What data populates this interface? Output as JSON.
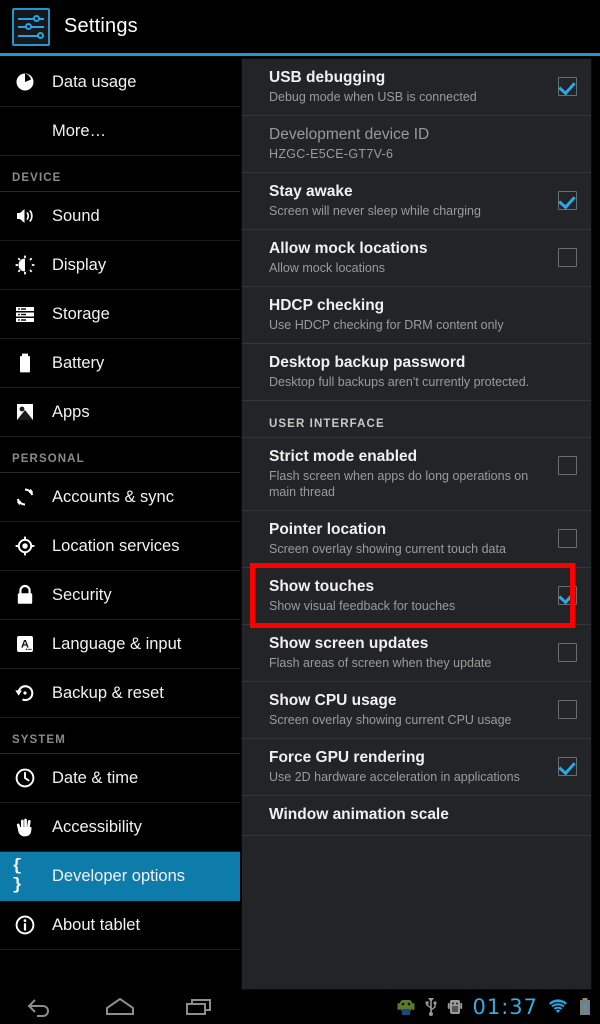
{
  "header": {
    "title": "Settings",
    "icon": "settings-sliders-icon",
    "accent_color": "#2196cf"
  },
  "sidebar": {
    "highlight_color": "#0d7cab",
    "items": [
      {
        "label": "Data usage",
        "icon": "pie-chart-icon",
        "type": "item",
        "selected": false
      },
      {
        "label": "More…",
        "icon": "",
        "type": "item-no-icon",
        "selected": false
      },
      {
        "label": "DEVICE",
        "type": "group"
      },
      {
        "label": "Sound",
        "icon": "speaker-icon",
        "type": "item",
        "selected": false
      },
      {
        "label": "Display",
        "icon": "brightness-icon",
        "type": "item",
        "selected": false
      },
      {
        "label": "Storage",
        "icon": "storage-stack-icon",
        "type": "item",
        "selected": false
      },
      {
        "label": "Battery",
        "icon": "battery-icon",
        "type": "item",
        "selected": false
      },
      {
        "label": "Apps",
        "icon": "android-apps-icon",
        "type": "item",
        "selected": false
      },
      {
        "label": "PERSONAL",
        "type": "group"
      },
      {
        "label": "Accounts & sync",
        "icon": "sync-arrows-icon",
        "type": "item",
        "selected": false
      },
      {
        "label": "Location services",
        "icon": "location-target-icon",
        "type": "item",
        "selected": false
      },
      {
        "label": "Security",
        "icon": "lock-icon",
        "type": "item",
        "selected": false
      },
      {
        "label": "Language & input",
        "icon": "language-a-icon",
        "type": "item",
        "selected": false
      },
      {
        "label": "Backup & reset",
        "icon": "restore-arrow-icon",
        "type": "item",
        "selected": false
      },
      {
        "label": "SYSTEM",
        "type": "group"
      },
      {
        "label": "Date & time",
        "icon": "clock-icon",
        "type": "item",
        "selected": false
      },
      {
        "label": "Accessibility",
        "icon": "hand-icon",
        "type": "item",
        "selected": false
      },
      {
        "label": "Developer options",
        "icon": "braces-icon",
        "type": "item",
        "selected": true
      },
      {
        "label": "About tablet",
        "icon": "info-circle-icon",
        "type": "item",
        "selected": false
      }
    ]
  },
  "panel": {
    "prefs": [
      {
        "kind": "pref",
        "title": "USB debugging",
        "summary": "Debug mode when USB is connected",
        "checkbox": "checked"
      },
      {
        "kind": "pref",
        "title": "Development device ID",
        "summary": "HZGC-E5CE-GT7V-6",
        "checkbox": "none",
        "disabled": true
      },
      {
        "kind": "pref",
        "title": "Stay awake",
        "summary": "Screen will never sleep while charging",
        "checkbox": "checked"
      },
      {
        "kind": "pref",
        "title": "Allow mock locations",
        "summary": "Allow mock locations",
        "checkbox": "unchecked"
      },
      {
        "kind": "pref",
        "title": "HDCP checking",
        "summary": "Use HDCP checking for DRM content only",
        "checkbox": "none"
      },
      {
        "kind": "pref",
        "title": "Desktop backup password",
        "summary": "Desktop full backups aren't currently protected.",
        "checkbox": "none"
      },
      {
        "kind": "section",
        "title": "USER INTERFACE"
      },
      {
        "kind": "pref",
        "title": "Strict mode enabled",
        "summary": "Flash screen when apps do long operations on main thread",
        "checkbox": "unchecked"
      },
      {
        "kind": "pref",
        "title": "Pointer location",
        "summary": "Screen overlay showing current touch data",
        "checkbox": "unchecked"
      },
      {
        "kind": "pref",
        "title": "Show touches",
        "summary": "Show visual feedback for touches",
        "checkbox": "checked",
        "highlighted": true
      },
      {
        "kind": "pref",
        "title": "Show screen updates",
        "summary": "Flash areas of screen when they update",
        "checkbox": "unchecked"
      },
      {
        "kind": "pref",
        "title": "Show CPU usage",
        "summary": "Screen overlay showing current CPU usage",
        "checkbox": "unchecked"
      },
      {
        "kind": "pref",
        "title": "Force GPU rendering",
        "summary": "Use 2D hardware acceleration in applications",
        "checkbox": "checked"
      },
      {
        "kind": "pref",
        "title": "Window animation scale",
        "summary": "",
        "checkbox": "none"
      }
    ]
  },
  "annotation": {
    "color": "#fc0000",
    "target": "Show touches"
  },
  "system_bar": {
    "buttons": [
      {
        "name": "back-button",
        "icon": "back-arrow-icon"
      },
      {
        "name": "home-button",
        "icon": "home-icon"
      },
      {
        "name": "recents-button",
        "icon": "recents-icon"
      }
    ],
    "status": {
      "icons": [
        "android-mascot-icon",
        "usb-icon",
        "adb-android-icon",
        "wifi-icon",
        "battery-charging-icon"
      ],
      "clock": "01:37",
      "clock_color": "#3aa9e0"
    }
  }
}
